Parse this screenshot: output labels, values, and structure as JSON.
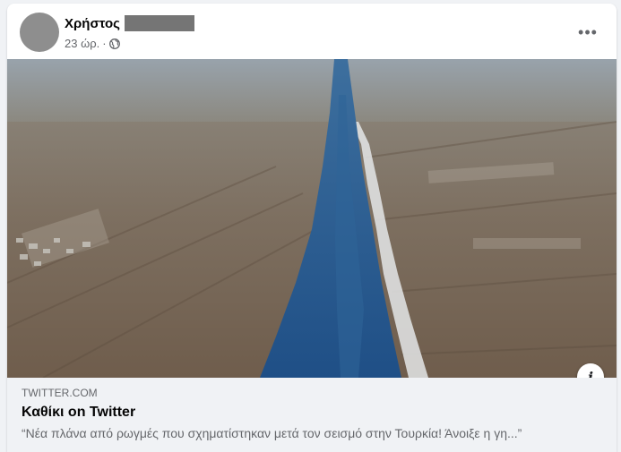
{
  "post": {
    "author_name": "Χρήστος",
    "time": "23 ώρ.",
    "separator": "·",
    "audience_icon": "globe-icon",
    "more_label": "•••"
  },
  "link_preview": {
    "domain": "TWITTER.COM",
    "title": "Καθίκι on Twitter",
    "description": "“Νέα πλάνα από ρωγμές που σχηματίστηκαν μετά τον σεισμό στην Τουρκία! Άνοιξε η γη...”",
    "info_label": "i"
  },
  "colors": {
    "page_bg": "#f0f2f5",
    "card_bg": "#ffffff",
    "secondary_text": "#65676b",
    "crack_water": "#2a5a8e"
  }
}
